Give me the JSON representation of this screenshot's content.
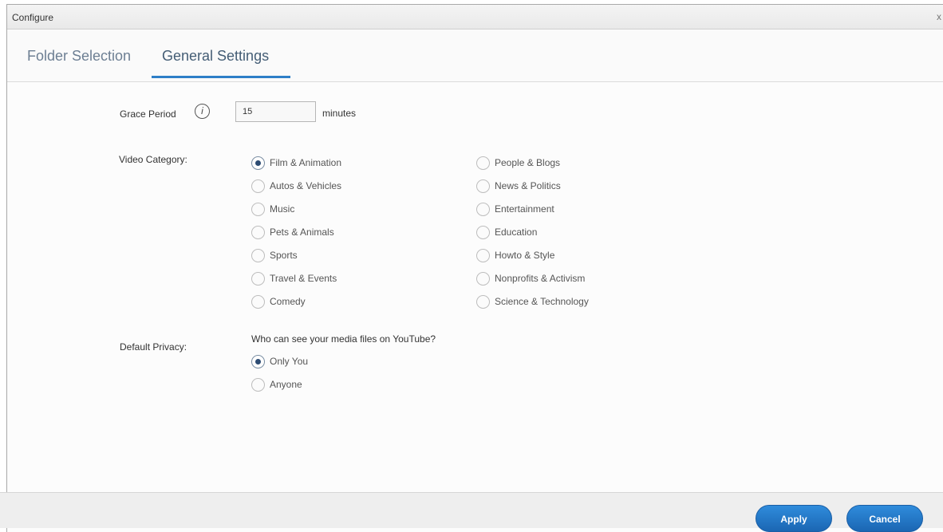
{
  "window": {
    "title": "Configure",
    "close_label": "x"
  },
  "tabs": [
    {
      "label": "Folder Selection",
      "active": false
    },
    {
      "label": "General Settings",
      "active": true
    }
  ],
  "grace_period": {
    "label": "Grace Period",
    "value": "15",
    "units": "minutes",
    "info_icon": "info-icon"
  },
  "video_category": {
    "label": "Video Category:",
    "options": [
      "Film & Animation",
      "Autos & Vehicles",
      "Music",
      "Pets & Animals",
      "Sports",
      "Travel & Events",
      "Comedy",
      "People & Blogs",
      "News & Politics",
      "Entertainment",
      "Education",
      "Howto & Style",
      "Nonprofits & Activism",
      "Science & Technology"
    ],
    "selected": "Film & Animation"
  },
  "default_privacy": {
    "label": "Default Privacy:",
    "question": "Who can see your media files on YouTube?",
    "options": [
      "Only You",
      "Anyone"
    ],
    "selected": "Only You"
  },
  "footer": {
    "apply_label": "Apply",
    "cancel_label": "Cancel"
  },
  "colors": {
    "accent": "#2e7fc7",
    "button": "#1f72c4"
  }
}
